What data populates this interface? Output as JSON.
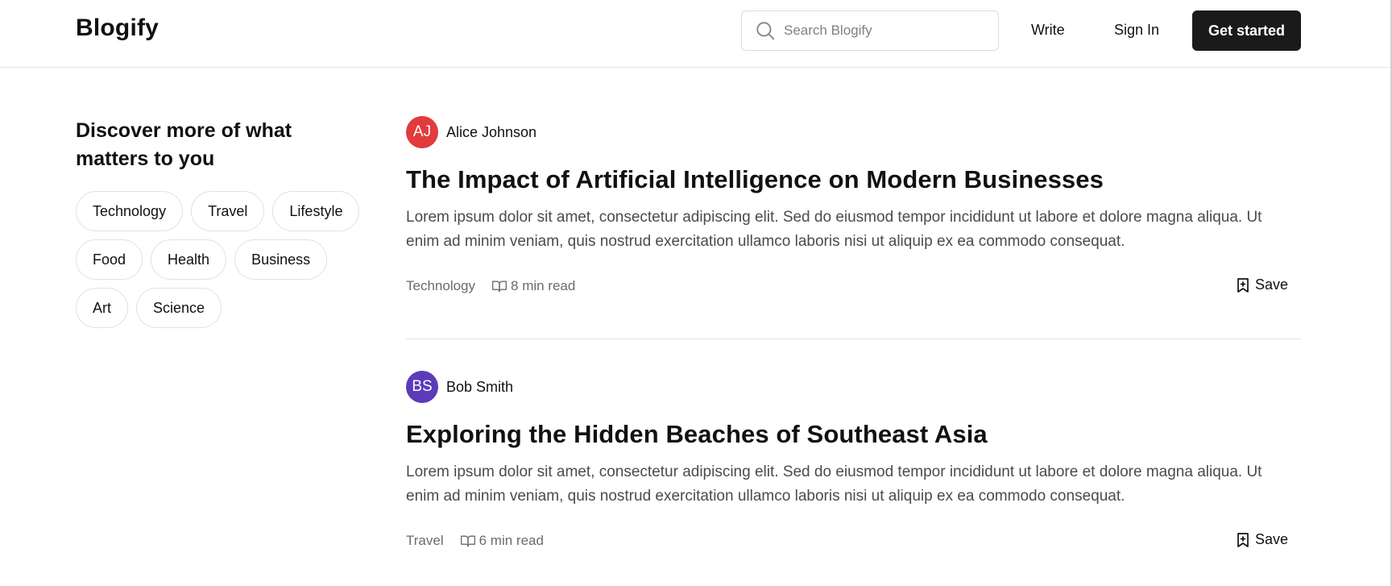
{
  "header": {
    "logo": "Blogify",
    "search_placeholder": "Search Blogify",
    "write_label": "Write",
    "signin_label": "Sign In",
    "cta_label": "Get started"
  },
  "sidebar": {
    "heading": "Discover more of what matters to you",
    "tags": [
      "Technology",
      "Travel",
      "Lifestyle",
      "Food",
      "Health",
      "Business",
      "Art",
      "Science"
    ]
  },
  "articles": [
    {
      "author_initials": "AJ",
      "author_name": "Alice Johnson",
      "avatar_color": "#e23b3b",
      "title": "The Impact of Artificial Intelligence on Modern Businesses",
      "excerpt": "Lorem ipsum dolor sit amet, consectetur adipiscing elit. Sed do eiusmod tempor incididunt ut labore et dolore magna aliqua. Ut enim ad minim veniam, quis nostrud exercitation ullamco laboris nisi ut aliquip ex ea commodo consequat.",
      "category": "Technology",
      "read_time": "8 min read",
      "save_label": "Save"
    },
    {
      "author_initials": "BS",
      "author_name": "Bob Smith",
      "avatar_color": "#5b3bb8",
      "title": "Exploring the Hidden Beaches of Southeast Asia",
      "excerpt": "Lorem ipsum dolor sit amet, consectetur adipiscing elit. Sed do eiusmod tempor incididunt ut labore et dolore magna aliqua. Ut enim ad minim veniam, quis nostrud exercitation ullamco laboris nisi ut aliquip ex ea commodo consequat.",
      "category": "Travel",
      "read_time": "6 min read",
      "save_label": "Save"
    }
  ],
  "colors": {
    "primary_button": "#1a1a1a",
    "border": "#e1e1e1",
    "muted_text": "#6b6b6b"
  }
}
